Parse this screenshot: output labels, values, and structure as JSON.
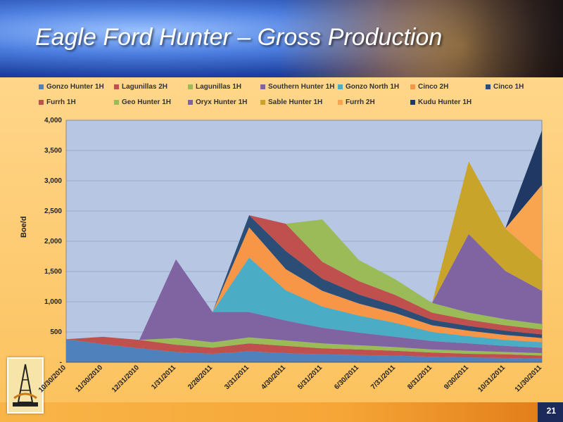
{
  "slide": {
    "title": "Eagle Ford Hunter – Gross Production",
    "slide_number": "21"
  },
  "colors": {
    "plot_bg": "#b7c7e3",
    "grid": "#7f8fb0"
  },
  "chart_data": {
    "type": "area",
    "stacked": true,
    "title": "",
    "xlabel": "",
    "ylabel": "Boe/d",
    "ylim": [
      0,
      4000
    ],
    "yticks": [
      0,
      500,
      1000,
      1500,
      2000,
      2500,
      3000,
      3500,
      4000
    ],
    "ytick_labels": [
      "-",
      "500",
      "1,000",
      "1,500",
      "2,000",
      "2,500",
      "3,000",
      "3,500",
      "4,000"
    ],
    "x_dates": [
      "10/30/2010",
      "11/30/2010",
      "12/31/2010",
      "1/31/2011",
      "2/28/2011",
      "3/31/2011",
      "4/30/2011",
      "5/31/2011",
      "6/30/2011",
      "7/31/2011",
      "8/31/2011",
      "9/30/2011",
      "10/31/2011",
      "11/30/2011"
    ],
    "legend_position": "top",
    "series": [
      {
        "name": "Gonzo Hunter 1H",
        "color": "#4f81bd",
        "values": [
          380,
          300,
          230,
          170,
          140,
          180,
          150,
          130,
          120,
          110,
          90,
          80,
          70,
          60
        ]
      },
      {
        "name": "Lagunillas 2H",
        "color": "#c0504d",
        "values": [
          0,
          120,
          140,
          120,
          100,
          130,
          120,
          100,
          90,
          80,
          70,
          60,
          60,
          50
        ]
      },
      {
        "name": "Lagunillas 1H",
        "color": "#9bbb59",
        "values": [
          0,
          0,
          0,
          110,
          90,
          100,
          90,
          80,
          70,
          60,
          50,
          50,
          40,
          40
        ]
      },
      {
        "name": "Southern Hunter 1H",
        "color": "#8064a2",
        "values": [
          0,
          0,
          0,
          1300,
          500,
          420,
          330,
          260,
          210,
          170,
          140,
          120,
          100,
          90
        ]
      },
      {
        "name": "Gonzo North 1H",
        "color": "#4bacc6",
        "values": [
          0,
          0,
          0,
          0,
          0,
          900,
          500,
          350,
          280,
          230,
          150,
          120,
          100,
          90
        ]
      },
      {
        "name": "Cinco 2H",
        "color": "#f79646",
        "values": [
          0,
          0,
          0,
          0,
          0,
          500,
          350,
          260,
          200,
          160,
          110,
          90,
          80,
          70
        ]
      },
      {
        "name": "Cinco 1H",
        "color": "#2c4d75",
        "values": [
          0,
          0,
          0,
          0,
          0,
          200,
          300,
          200,
          150,
          120,
          90,
          80,
          70,
          60
        ]
      },
      {
        "name": "Furrh 1H",
        "color": "#c0504d",
        "values": [
          0,
          0,
          0,
          0,
          0,
          0,
          450,
          280,
          220,
          180,
          120,
          100,
          90,
          80
        ]
      },
      {
        "name": "Geo Hunter 1H",
        "color": "#9bbb59",
        "values": [
          0,
          0,
          0,
          0,
          0,
          0,
          0,
          700,
          350,
          260,
          160,
          120,
          100,
          90
        ]
      },
      {
        "name": "Oryx Hunter 1H",
        "color": "#8064a2",
        "values": [
          0,
          0,
          0,
          0,
          0,
          0,
          0,
          0,
          0,
          0,
          0,
          1300,
          800,
          550
        ]
      },
      {
        "name": "Sable Hunter 1H",
        "color": "#c9a42b",
        "values": [
          0,
          0,
          0,
          0,
          0,
          0,
          0,
          0,
          0,
          0,
          0,
          1200,
          700,
          500
        ]
      },
      {
        "name": "Furrh 2H",
        "color": "#f9a44e",
        "values": [
          0,
          0,
          0,
          0,
          0,
          0,
          0,
          0,
          0,
          0,
          0,
          0,
          0,
          1250
        ]
      },
      {
        "name": "Kudu Hunter 1H",
        "color": "#1f3864",
        "values": [
          0,
          0,
          0,
          0,
          0,
          0,
          0,
          0,
          0,
          0,
          0,
          0,
          0,
          900
        ]
      }
    ]
  }
}
